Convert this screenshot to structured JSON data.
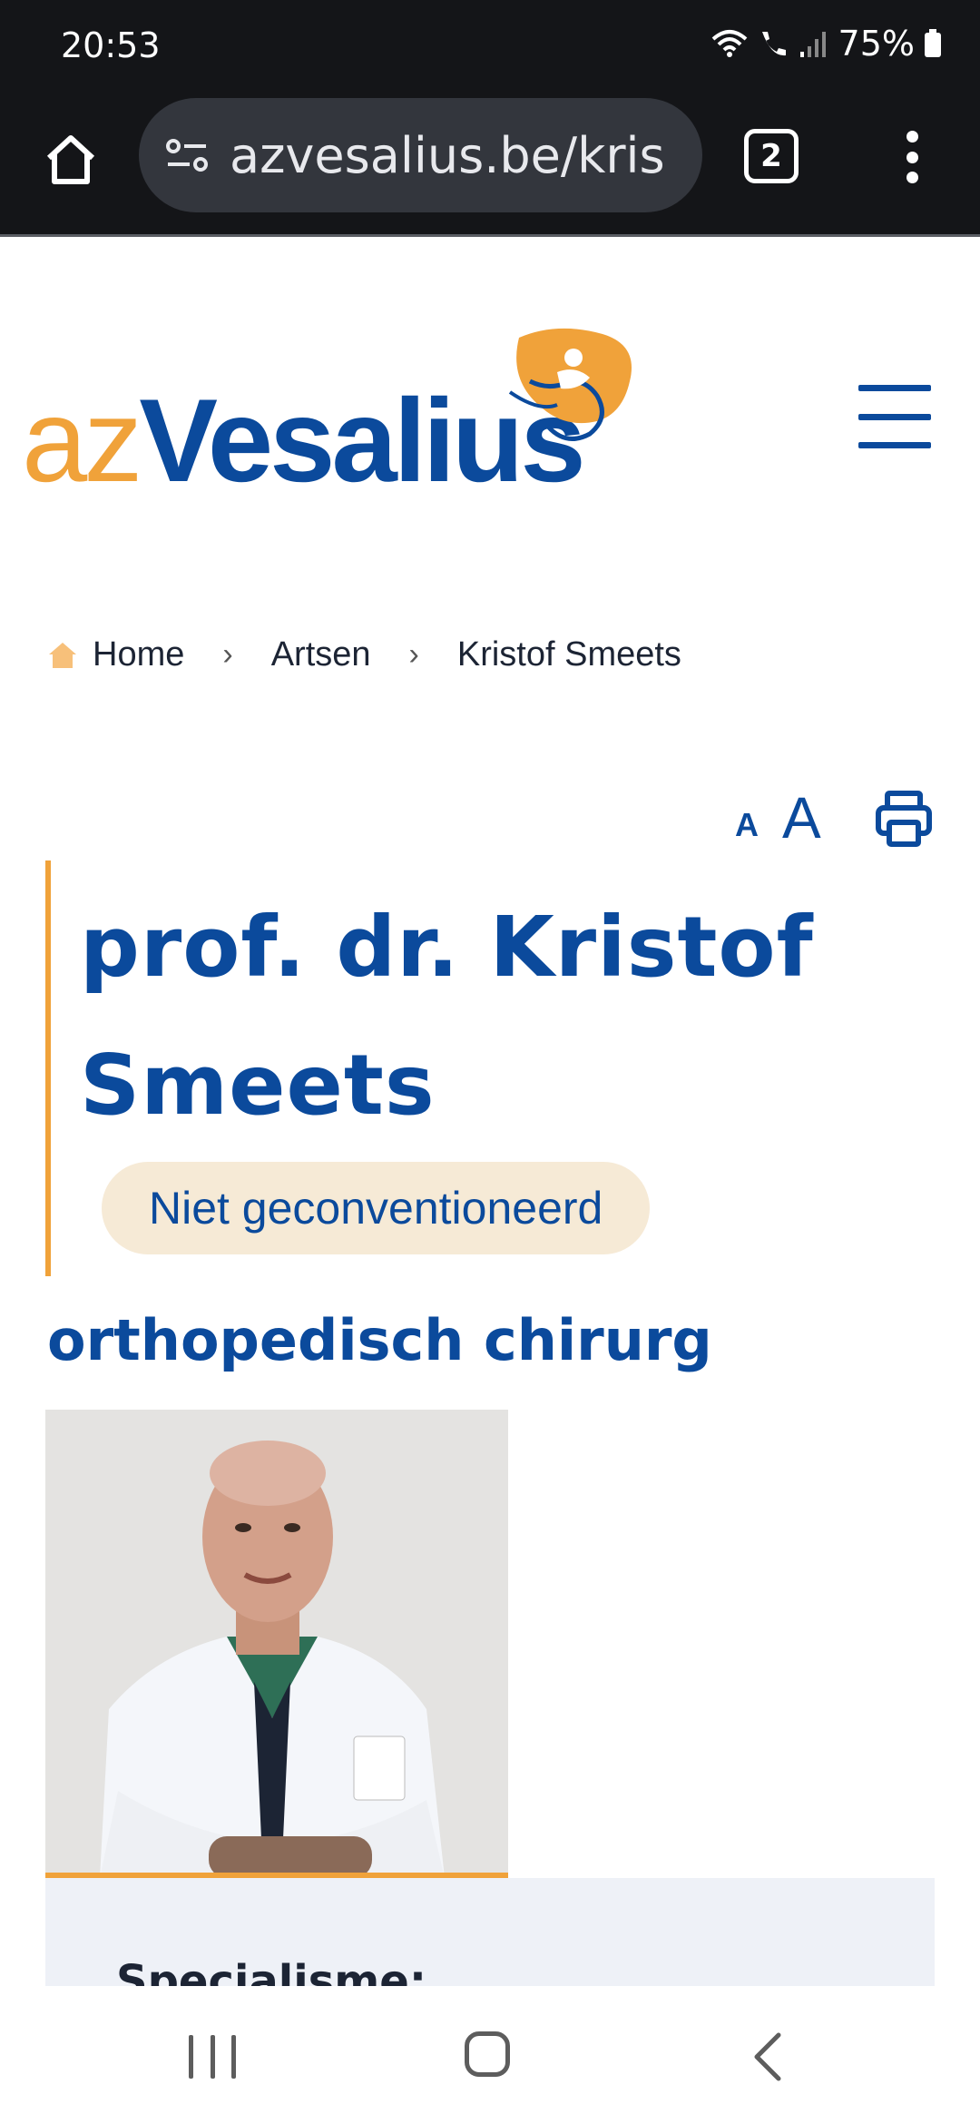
{
  "status_bar": {
    "time": "20:53",
    "battery": "75%",
    "icons": [
      "wifi-icon",
      "wifi-call-icon",
      "signal-icon",
      "battery-icon"
    ]
  },
  "browser": {
    "url": "azvesalius.be/kris",
    "tab_count": "2"
  },
  "site": {
    "logo_az": "az",
    "logo_name": "Vesalius",
    "colors": {
      "brand_blue": "#0b4a9c",
      "brand_orange": "#f0a23a",
      "badge_bg": "#f6ead6"
    }
  },
  "breadcrumb": {
    "items": [
      "Home",
      "Artsen",
      "Kristof Smeets"
    ]
  },
  "tools": {
    "font_small": "A",
    "font_large": "A"
  },
  "doctor": {
    "name": "prof. dr. Kristof Smeets",
    "badge": "Niet geconventioneerd",
    "role": "orthopedisch chirurg",
    "section_label": "Specialisme:"
  }
}
